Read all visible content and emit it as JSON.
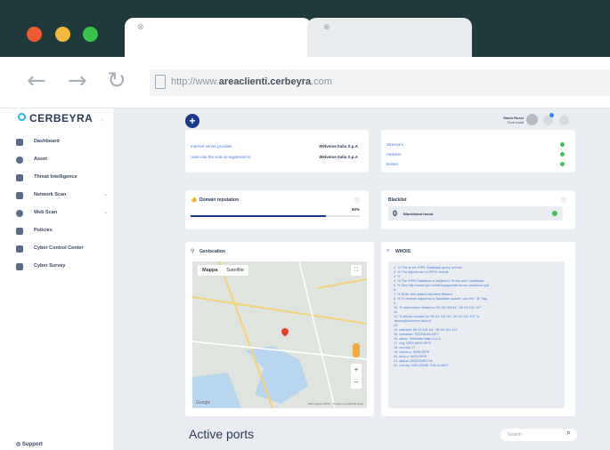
{
  "browser": {
    "url_prefix": "http://www.",
    "url_domain": "areaclienti.cerbeyra",
    "url_suffix": ".com"
  },
  "sidebar": {
    "logo": "CERBEYRA",
    "items": [
      {
        "label": "Dashboard",
        "icon": "grid-icon"
      },
      {
        "label": "Asset",
        "icon": "asset-icon"
      },
      {
        "label": "Threat Intelligence",
        "icon": "lock-icon"
      },
      {
        "label": "Network Scan",
        "icon": "network-icon",
        "chevron": true
      },
      {
        "label": "Web Scan",
        "icon": "globe-icon",
        "chevron": true
      },
      {
        "label": "Policies",
        "icon": "policy-icon"
      },
      {
        "label": "Cyber Control Center",
        "icon": "control-icon"
      },
      {
        "label": "Cyber Survey",
        "icon": "survey-icon"
      }
    ],
    "support": "Support"
  },
  "topbar": {
    "plus": "+",
    "user_name": "Mario Rossi",
    "user_role": "Tech Lead"
  },
  "info_card": {
    "rows": [
      {
        "key": "Internet server provider",
        "value": "Welveine Italia S.p.A"
      },
      {
        "key": "User-role the scan is registered to",
        "value": "Welveine Italia S.p.A"
      }
    ]
  },
  "status_card": {
    "rows": [
      "Stressors",
      "Attacker",
      "Botnet"
    ]
  },
  "reputation": {
    "title": "Domain reputation",
    "percent": "80%",
    "fill": 0.8
  },
  "blacklist": {
    "title": "Blacklist",
    "count": "0",
    "label": "Blacklisted found"
  },
  "geolocation": {
    "title": "Geolocation",
    "tab_map": "Mappa",
    "tab_satellite": "Satellite",
    "zoom_in": "+",
    "zoom_out": "−",
    "google": "Google",
    "credits": "Dati mappa ©2020 · Termini e condizioni d'uso"
  },
  "whois": {
    "title": "WHOIS",
    "lines": [
      "1.  % This is the RIPE Database query service.",
      "2.  % The objects are in RPSL format.",
      "3.  %",
      "4.  % The RIPE Database is subject to Terms and Conditions.",
      "5.  % See http://www.ripe.net/db/support/db-terms-conditions.pdf",
      "6.",
      "7.  % Note: this output has been filtered.",
      "8.  % To receive output for a database update, use the \"-B\" flag.",
      "9.",
      "10. % Information related to '80.93.151.64 - 80.93.151.127'",
      "11.",
      "12. % Abuse contact for '80.93.151.64 - 80.93.151.127' is",
      "    'abuse@welveine-italia.it'",
      "13.",
      "14. inetnum:  80.93.151.64 - 80.93.151.127",
      "15. netname:  TOOSEAN-NET",
      "16. descr:    Welveine Italia S.p.A.",
      "17. org:      ORG-WISI-RIPE",
      "18. country:  IT",
      "19. admin-c:  WISI-RIPE",
      "20. tech-c:   WISI-RIPE",
      "21. status:   ASSIGNED PA",
      "22. mnt-by:   WELVEINE-ITALIA-MNT"
    ]
  },
  "ports": {
    "title": "Active ports",
    "search_placeholder": "Search"
  }
}
